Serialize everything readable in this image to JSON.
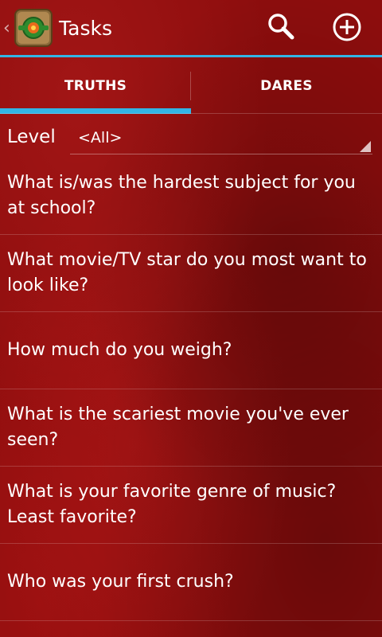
{
  "action_bar": {
    "title": "Tasks",
    "icons": {
      "up": "chevron-left-icon",
      "app": "bottle-spinner-icon",
      "search": "search-icon",
      "add": "add-circle-icon"
    }
  },
  "tabs": [
    {
      "label": "TRUTHS",
      "selected": true
    },
    {
      "label": "DARES",
      "selected": false
    }
  ],
  "filter": {
    "label": "Level",
    "value": "<All>"
  },
  "tasks": [
    "What is/was the hardest subject for you at school?",
    "What movie/TV star do you most want to look like?",
    "How much do you weigh?",
    "What is the scariest movie you've ever seen?",
    "What is your favorite genre of music? Least favorite?",
    "Who was your first crush?"
  ],
  "colors": {
    "accent": "#33b5e5",
    "background": "#8d0d0d",
    "text": "#ffffff"
  }
}
